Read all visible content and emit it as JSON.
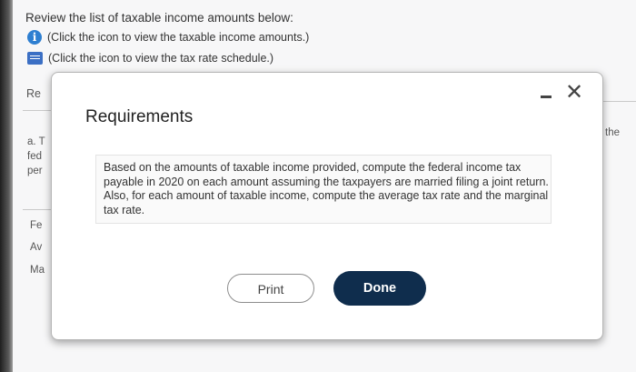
{
  "intro": "Review the list of taxable income amounts below:",
  "links": {
    "income_link": "(Click the icon to view the taxable income amounts.)",
    "schedule_link": "(Click the icon to view the tax rate schedule.)"
  },
  "background_fragments": {
    "re": "Re",
    "a_t": "a. T",
    "fed": "fed",
    "per": "per",
    "fe": "Fe",
    "av": "Av",
    "ma": "Ma",
    "the": "the"
  },
  "modal": {
    "title": "Requirements",
    "requirement_text": "Based on the amounts of taxable income provided, compute the federal income tax payable in 2020 on each amount assuming the taxpayers are married filing a joint return. Also, for each amount of taxable income, compute the average tax rate and the marginal tax rate.",
    "print_label": "Print",
    "done_label": "Done",
    "close_glyph": "✕"
  }
}
